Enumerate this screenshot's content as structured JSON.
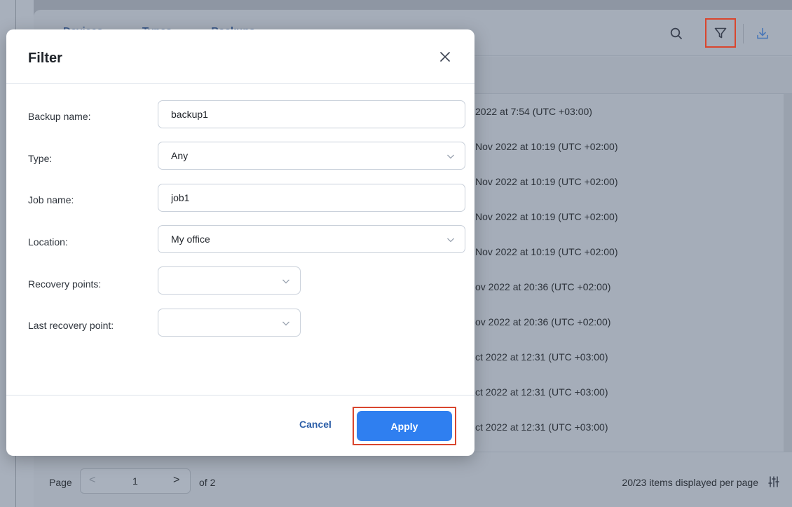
{
  "background": {
    "tabs": [
      "Devices",
      "Types",
      "Backups"
    ],
    "rows": [
      "2022 at 7:54 (UTC +03:00)",
      "Nov 2022 at 10:19 (UTC +02:00)",
      "Nov 2022 at 10:19 (UTC +02:00)",
      "Nov 2022 at 10:19 (UTC +02:00)",
      "Nov 2022 at 10:19 (UTC +02:00)",
      "ov 2022 at 20:36 (UTC +02:00)",
      "ov 2022 at 20:36 (UTC +02:00)",
      "ct 2022 at 12:31 (UTC +03:00)",
      "ct 2022 at 12:31 (UTC +03:00)",
      "ct 2022 at 12:31 (UTC +03:00)"
    ],
    "footer": {
      "page_label": "Page",
      "prev": "<",
      "page_number": "1",
      "next": ">",
      "of_label": "of 2",
      "items_label": "20/23 items displayed per page"
    },
    "header_icons": [
      "search-icon",
      "filter-icon",
      "download-icon"
    ]
  },
  "modal": {
    "title": "Filter",
    "close_icon": "close-icon",
    "fields": {
      "backup_name": {
        "label": "Backup name:",
        "value": "backup1"
      },
      "type": {
        "label": "Type:",
        "value": "Any"
      },
      "job_name": {
        "label": "Job name:",
        "value": "job1"
      },
      "location": {
        "label": "Location:",
        "value": "My office"
      },
      "recovery_points": {
        "label": "Recovery points:",
        "value": ""
      },
      "last_recovery_point": {
        "label": "Last recovery point:",
        "value": ""
      }
    },
    "cancel_label": "Cancel",
    "apply_label": "Apply"
  },
  "colors": {
    "accent": "#2f7ff0",
    "highlight": "#d9462e",
    "link": "#2d5fa8"
  }
}
